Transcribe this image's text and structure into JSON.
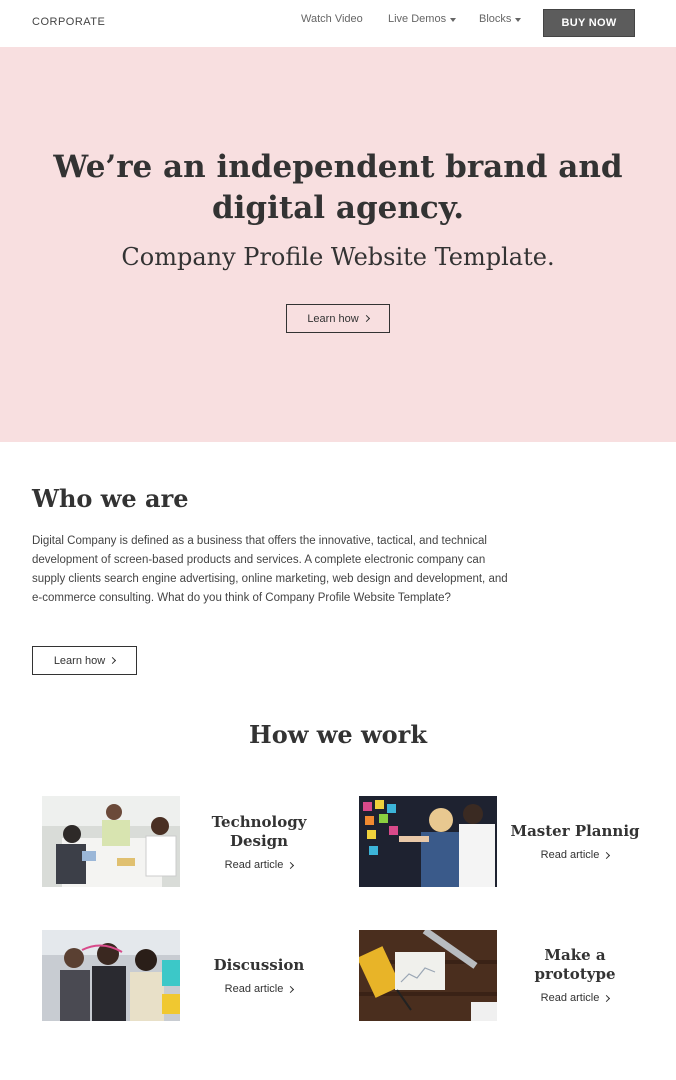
{
  "navbar": {
    "brand": "CORPORATE",
    "links": [
      {
        "label": "Watch Video"
      },
      {
        "label": "Live Demos"
      },
      {
        "label": "Blocks"
      }
    ],
    "buy_label": "BUY NOW"
  },
  "hero": {
    "title": "We’re an independent brand and digital agency.",
    "subtitle": "Company Profile Website Template.",
    "button_label": "Learn how",
    "background": "#f8dfe0"
  },
  "about": {
    "title": "Who we are",
    "text": "Digital Company is defined as a business that offers the innovative, tactical, and technical development of screen-based products and services. A complete electronic company can supply clients search engine advertising, online marketing, web design and development, and e-commerce consulting. What do you think of Company Profile Website Template?",
    "button_label": "Learn how"
  },
  "how": {
    "title": "How we work",
    "cards": [
      {
        "title": "Technology Design",
        "link": "Read article"
      },
      {
        "title": "Master Plannig",
        "link": "Read article"
      },
      {
        "title": "Discussion",
        "link": "Read article"
      },
      {
        "title": "Make a prototype",
        "link": "Read article"
      }
    ]
  }
}
